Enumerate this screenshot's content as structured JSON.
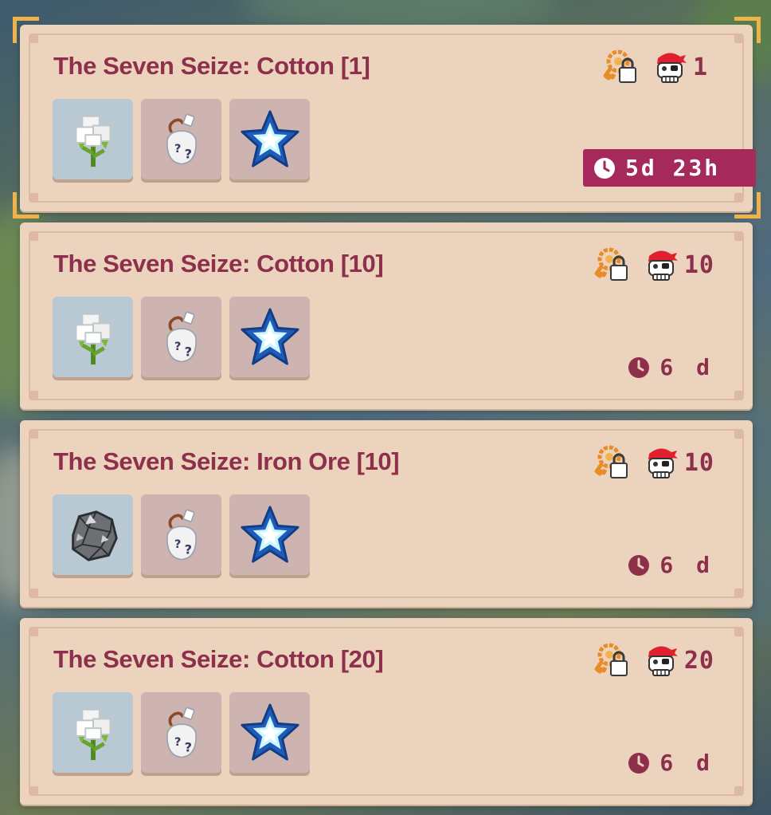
{
  "quests": [
    {
      "title": "The Seven Seize: Cotton [1]",
      "level": "1",
      "timer": "5d 23h",
      "selected": true,
      "resource": "cotton"
    },
    {
      "title": "The Seven Seize: Cotton [10]",
      "level": "10",
      "timer": "6 d",
      "selected": false,
      "resource": "cotton"
    },
    {
      "title": "The Seven Seize: Iron Ore [10]",
      "level": "10",
      "timer": "6 d",
      "selected": false,
      "resource": "iron-ore"
    },
    {
      "title": "The Seven Seize: Cotton [20]",
      "level": "20",
      "timer": "6 d",
      "selected": false,
      "resource": "cotton"
    }
  ],
  "icons": {
    "key_lock": "key-lock-icon",
    "pirate": "pirate-skull-icon",
    "clock": "clock-icon",
    "mystery_bag": "mystery-bag-icon",
    "star": "star-icon"
  },
  "colors": {
    "card_bg": "#ecd3bd",
    "title": "#8e2f4c",
    "timer_badge": "#a5295a",
    "selection_bracket": "#f0b24a",
    "resource_slot": "#b8c9d3",
    "reward_slot": "#cdb4b1"
  }
}
